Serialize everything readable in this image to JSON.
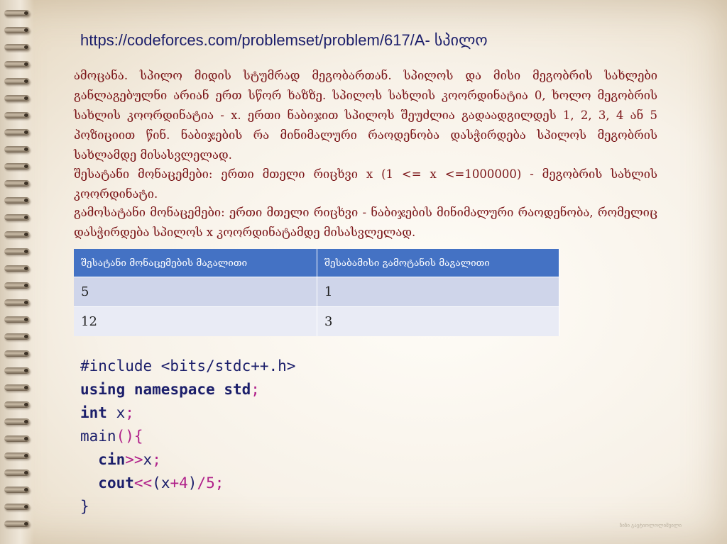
{
  "url": {
    "link": "https://codeforces.com/problemset/problem/",
    "rest": "617/A- სპილო"
  },
  "problem": {
    "statement": "ამოცანა. სპილო მიდის სტუმრად მეგობართან. სპილოს და მისი მეგობრის სახლები განლაგებულნი არიან ერთ სწორ ხაზზე. სპილოს სახლის კოორდინატია 0, ხოლო მეგობრის სახლის კოორდინატია - x. ერთი ნაბიჯით სპილოს შეუძლია გადაადგილდეს 1, 2, 3, 4 ან 5 პოზიციით წინ. ნაბიჯების რა მინიმალური რაოდენობა დასჭირდება სპილოს მეგობრის სახლამდე მისასვლელად.",
    "input": "შესატანი მონაცემები: ერთი მთელი რიცხვი x (1 <= x <=1000000) - მეგობრის სახლის კოორდინატი.",
    "output": "გამოსატანი მონაცემები: ერთი მთელი რიცხვი - ნაბიჯების მინიმალური რაოდენობა, რომელიც დასჭირდება სპილოს x კოორდინატამდე მისასვლელად."
  },
  "examples": {
    "headers": [
      "შესატანი მონაცემების მაგალითი",
      "შესაბამისი გამოტანის მაგალითი"
    ],
    "rows": [
      [
        "5",
        "1"
      ],
      [
        "12",
        "3"
      ]
    ]
  },
  "code": {
    "line1": "#include <bits/stdc++.h>",
    "line2_kw1": "using",
    "line2_kw2": "namespace",
    "line2_kw3": "std",
    "line2_end": ";",
    "line3_kw": "int",
    "line3_rest": " x",
    "line3_end": ";",
    "line4_name": "main",
    "line4_paren": "(){",
    "line5_kw": "cin",
    "line5_op": ">>",
    "line5_var": "x",
    "line5_end": ";",
    "line6_kw": "cout",
    "line6_op": "<<",
    "line6_a": "(x",
    "line6_plus": "+",
    "line6_four": "4",
    "line6_b": ")",
    "line6_div": "/",
    "line6_five": "5",
    "line6_end": ";",
    "line7": "}"
  },
  "footer": "ზიზი გაეტიოლოლიშვილი"
}
